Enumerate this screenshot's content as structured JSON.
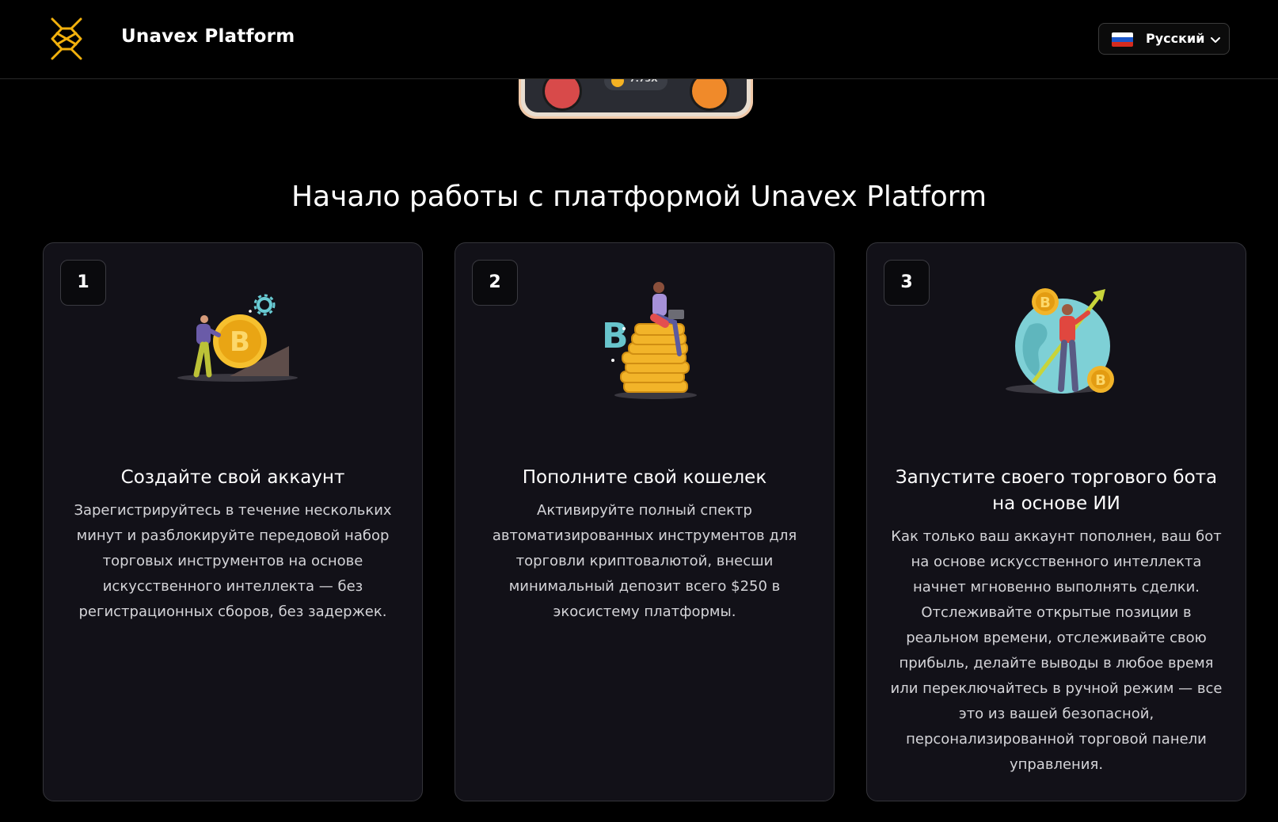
{
  "header": {
    "brand": "Unavex Platform",
    "logo_color": "#f2b10d",
    "language": {
      "label": "Русский",
      "flag": "ru-flag"
    }
  },
  "hero_mockup": {
    "multiplier": "7.73X"
  },
  "section": {
    "title": "Начало работы с платформой Unavex Platform"
  },
  "steps": [
    {
      "number": "1",
      "icon": "bitcoin-push-illustration",
      "title": "Создайте свой аккаунт",
      "text": "Зарегистрируйтесь в течение нескольких минут и разблокируйте передовой набор торговых инструментов на основе искусственного интеллекта — без регистрационных сборов, без задержек."
    },
    {
      "number": "2",
      "icon": "coin-stack-illustration",
      "title": "Пополните свой кошелек",
      "text": "Активируйте полный спектр автоматизированных инструментов для торговли криптовалютой, внесши минимальный депозит всего $250 в экосистему платформы."
    },
    {
      "number": "3",
      "icon": "globe-growth-illustration",
      "title": "Запустите своего торгового бота на основе ИИ",
      "text": "Как только ваш аккаунт пополнен, ваш бот на основе искусственного интеллекта начнет мгновенно выполнять сделки. Отслеживайте открытые позиции в реальном времени, отслеживайте свою прибыль, делайте выводы в любое время или переключайтесь в ручной режим — все это из вашей безопасной, персонализированной торговой панели управления."
    }
  ]
}
